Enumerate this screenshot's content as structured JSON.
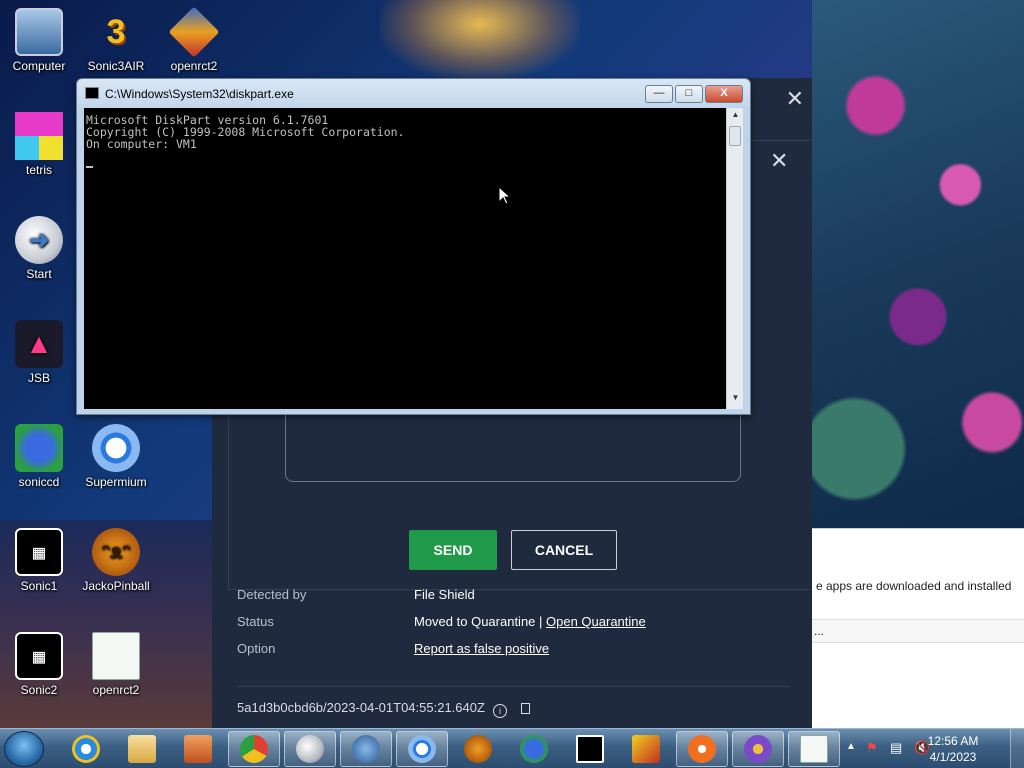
{
  "desktop_icons": [
    {
      "label": "Computer",
      "icon": "computer-icon"
    },
    {
      "label": "Sonic3AIR",
      "icon": "sonic3air-icon"
    },
    {
      "label": "openrct2",
      "icon": "openrct2-icon"
    },
    {
      "label": "tetris",
      "icon": "tetris-icon"
    },
    {
      "label": "Start",
      "icon": "start-app-icon"
    },
    {
      "label": "JSB",
      "icon": "jsb-icon"
    },
    {
      "label": "soniccd",
      "icon": "soniccd-icon"
    },
    {
      "label": "Supermium",
      "icon": "supermium-icon"
    },
    {
      "label": "Sonic1",
      "icon": "sonic1-icon"
    },
    {
      "label": "JackoPinball",
      "icon": "jackopinball-icon"
    },
    {
      "label": "Sonic2",
      "icon": "sonic2-icon"
    },
    {
      "label": "openrct2",
      "icon": "openrct2-doc-icon"
    }
  ],
  "cmd": {
    "title": "C:\\Windows\\System32\\diskpart.exe",
    "lines": [
      "Microsoft DiskPart version 6.1.7601",
      "Copyright (C) 1999-2008 Microsoft Corporation.",
      "On computer: VM1"
    ],
    "buttons": {
      "minimize": "—",
      "maximize": "□",
      "close": "X"
    }
  },
  "avast": {
    "send_label": "SEND",
    "cancel_label": "CANCEL",
    "details": [
      {
        "key": "Detected by",
        "value": "File Shield"
      },
      {
        "key": "Status",
        "value": "Moved to Quarantine",
        "separator": " | ",
        "link": "Open Quarantine"
      },
      {
        "key": "Option",
        "value": "",
        "link": "Report as false positive"
      }
    ],
    "hash": "5a1d3b0cbd6b/2023-04-01T04:55:21.640Z",
    "colors": {
      "send": "#1e9a48",
      "panel": "#1f2a3e"
    }
  },
  "background_window": {
    "text": "e apps are downloaded and installed",
    "row_text": "..."
  },
  "taskbar": {
    "pinned": [
      "internet-explorer-icon",
      "explorer-icon",
      "media-player-icon",
      "chrome-icon",
      "start-app-icon",
      "network-icon",
      "supermium-icon",
      "jackopinball-icon",
      "sonic-icon",
      "sonic1-icon",
      "game-icon",
      "avast-icon",
      "vpn-icon",
      "diskpart-icon"
    ],
    "clock_time": "12:56 AM",
    "clock_date": "4/1/2023"
  }
}
